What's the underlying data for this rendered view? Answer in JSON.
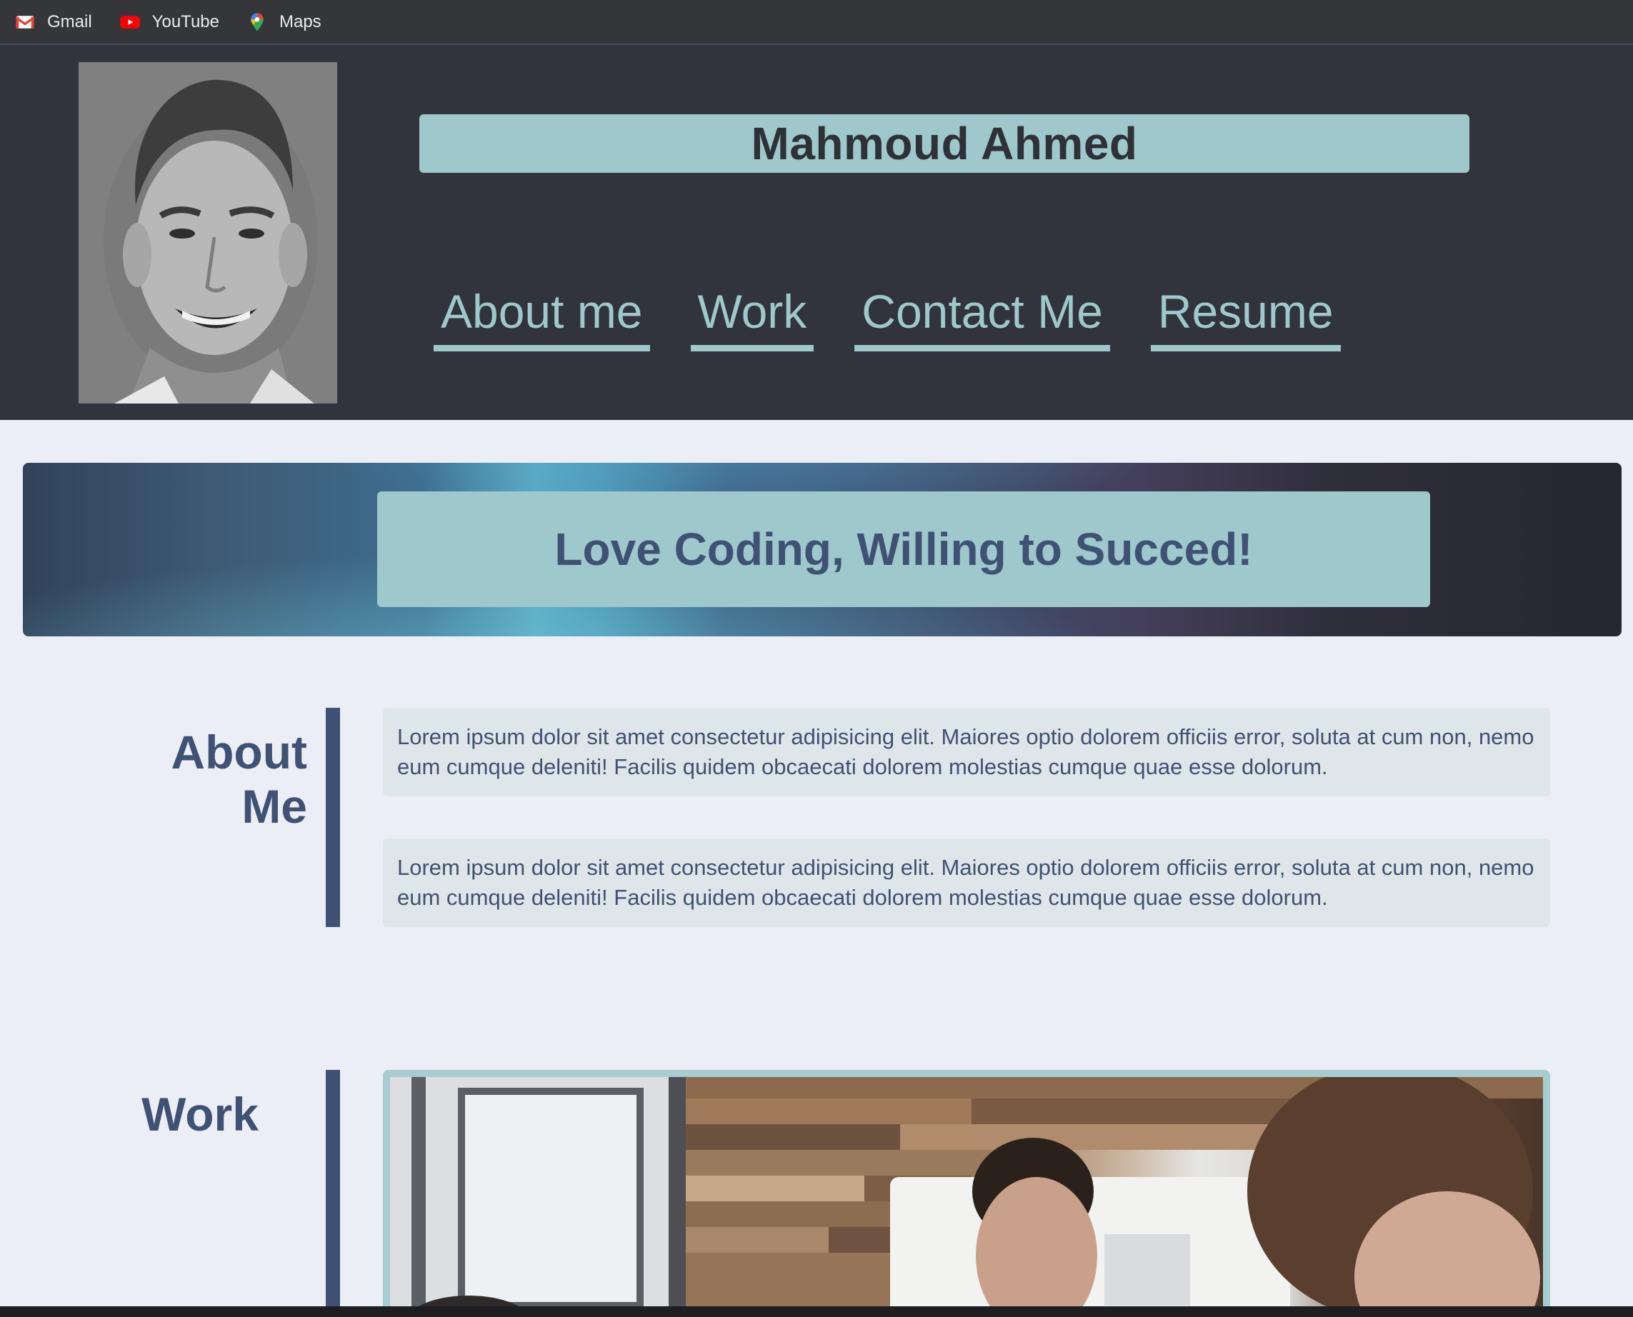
{
  "bookmarks": [
    {
      "label": "Gmail",
      "icon": "gmail-icon"
    },
    {
      "label": "YouTube",
      "icon": "youtube-icon"
    },
    {
      "label": "Maps",
      "icon": "maps-icon"
    }
  ],
  "header": {
    "name": "Mahmoud Ahmed",
    "nav": [
      "About me",
      "Work",
      "Contact Me",
      "Resume"
    ]
  },
  "banner": {
    "tagline": "Love Coding, Willing to Succed!"
  },
  "about": {
    "title": "About Me",
    "paragraphs": [
      "Lorem ipsum dolor sit amet consectetur adipisicing elit. Maiores optio dolorem officiis error, soluta at cum non, nemo eum cumque deleniti! Facilis quidem obcaecati dolorem molestias cumque quae esse dolorum.",
      "Lorem ipsum dolor sit amet consectetur adipisicing elit. Maiores optio dolorem officiis error, soluta at cum non, nemo eum cumque deleniti! Facilis quidem obcaecati dolorem molestias cumque quae esse dolorum."
    ]
  },
  "work": {
    "title": "Work"
  },
  "colors": {
    "header_bg": "#31333d",
    "accent": "#9ec8cb",
    "text_dark": "#3f5273",
    "page_bg": "#eceef5"
  }
}
